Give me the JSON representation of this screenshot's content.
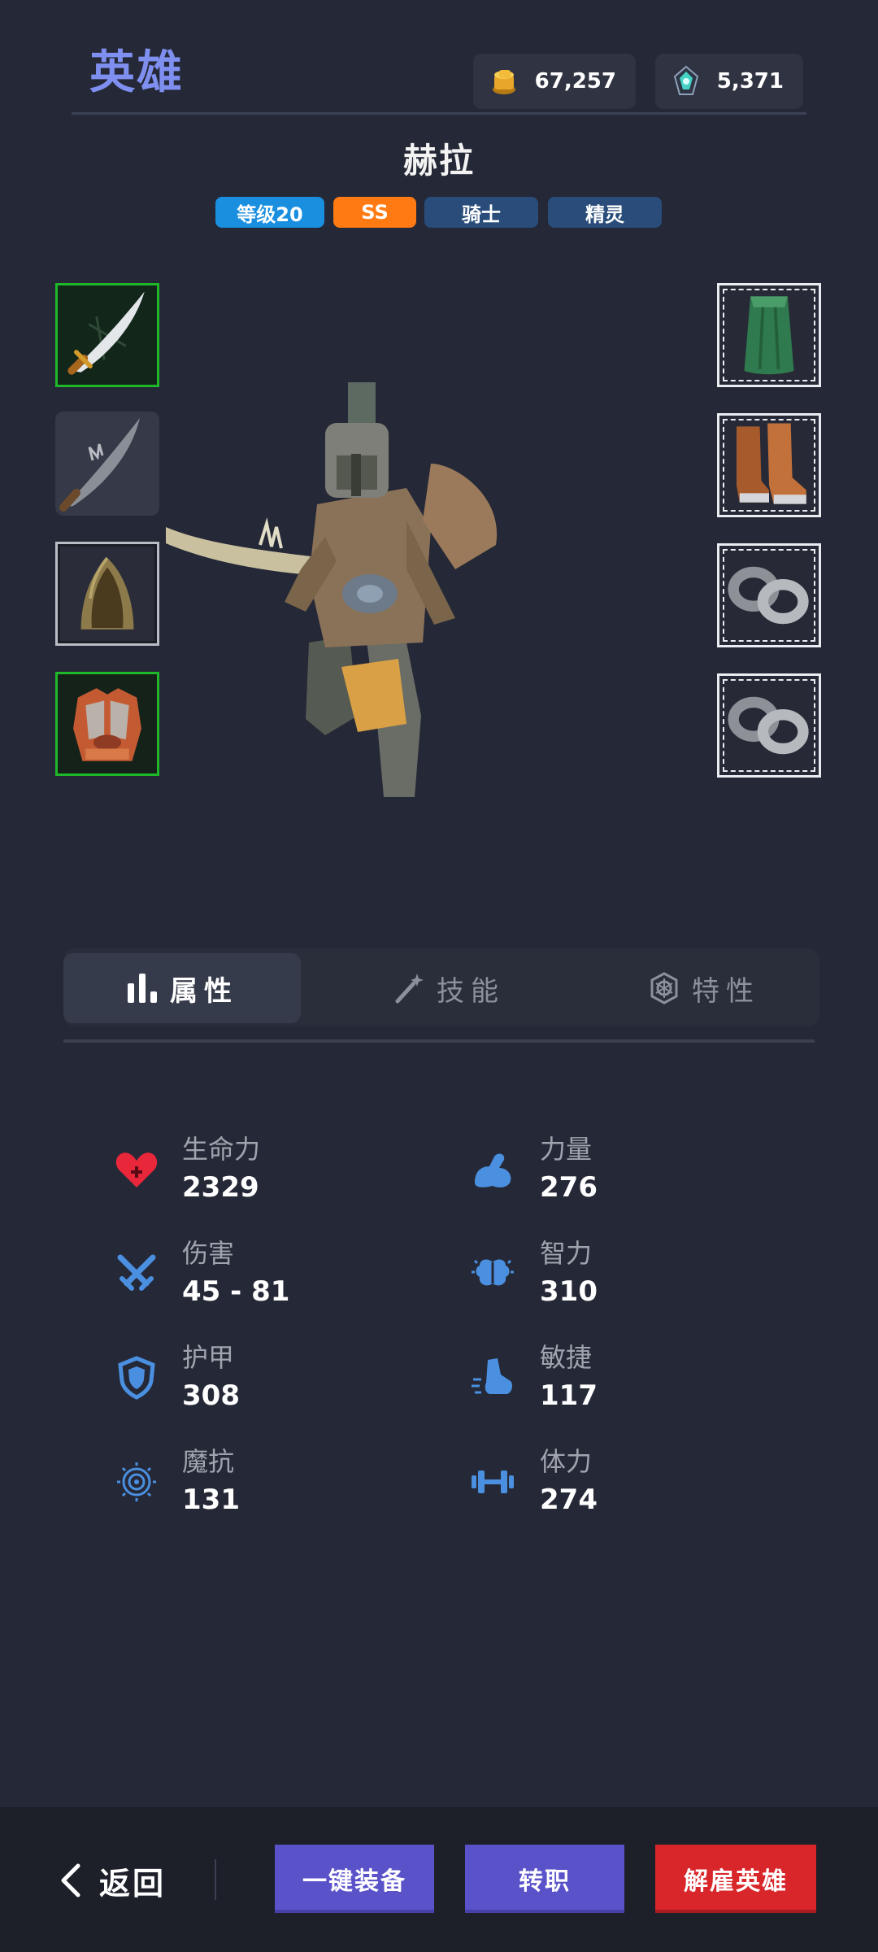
{
  "header": {
    "title": "英雄",
    "currency": [
      {
        "icon": "gold-coins-icon",
        "value": "67,257"
      },
      {
        "icon": "soul-gem-icon",
        "value": "5,371"
      }
    ]
  },
  "hero": {
    "name": "赫拉",
    "tags": [
      {
        "label": "等级20",
        "color": "#1a8fe0"
      },
      {
        "label": "SS",
        "color": "#ff7a12"
      },
      {
        "label": "骑士",
        "color": "#294c7a"
      },
      {
        "label": "精灵",
        "color": "#294c7a"
      }
    ]
  },
  "equipment": {
    "left": [
      {
        "icon": "scimitar-weapon-icon",
        "state": "equipped-green"
      },
      {
        "icon": "scimitar-offhand-icon",
        "state": "empty"
      },
      {
        "icon": "leather-hood-icon",
        "state": "equipped-grey"
      },
      {
        "icon": "chest-armor-icon",
        "state": "equipped-green"
      }
    ],
    "right": [
      {
        "icon": "green-cloak-icon",
        "state": "equipped-white"
      },
      {
        "icon": "leather-boots-icon",
        "state": "equipped-white"
      },
      {
        "icon": "iron-rings-icon",
        "state": "equipped-white"
      },
      {
        "icon": "iron-rings-icon",
        "state": "equipped-white"
      }
    ]
  },
  "tabs": [
    {
      "label": "属性",
      "icon": "bar-chart-icon",
      "active": true
    },
    {
      "label": "技能",
      "icon": "magic-wand-icon",
      "active": false
    },
    {
      "label": "特性",
      "icon": "trait-emblem-icon",
      "active": false
    }
  ],
  "stats": {
    "left": [
      {
        "label": "生命力",
        "value": "2329",
        "icon": "heart-icon"
      },
      {
        "label": "伤害",
        "value": "45 - 81",
        "icon": "crossed-swords-icon"
      },
      {
        "label": "护甲",
        "value": "308",
        "icon": "shield-icon"
      },
      {
        "label": "魔抗",
        "value": "131",
        "icon": "magic-swirl-icon"
      }
    ],
    "right": [
      {
        "label": "力量",
        "value": "276",
        "icon": "flexed-arm-icon"
      },
      {
        "label": "智力",
        "value": "310",
        "icon": "brain-icon"
      },
      {
        "label": "敏捷",
        "value": "117",
        "icon": "running-boot-icon"
      },
      {
        "label": "体力",
        "value": "274",
        "icon": "dumbbell-icon"
      }
    ]
  },
  "footer": {
    "back_label": "返回",
    "equip_all_label": "一键装备",
    "change_class_label": "转职",
    "dismiss_label": "解雇英雄"
  },
  "colors": {
    "background": "#252836",
    "accent_title": "#7f8ff0",
    "stat_icon": "#4a8fe0",
    "health_icon": "#e8283a",
    "action_purple": "#5a52c9",
    "action_red": "#d8262a"
  }
}
